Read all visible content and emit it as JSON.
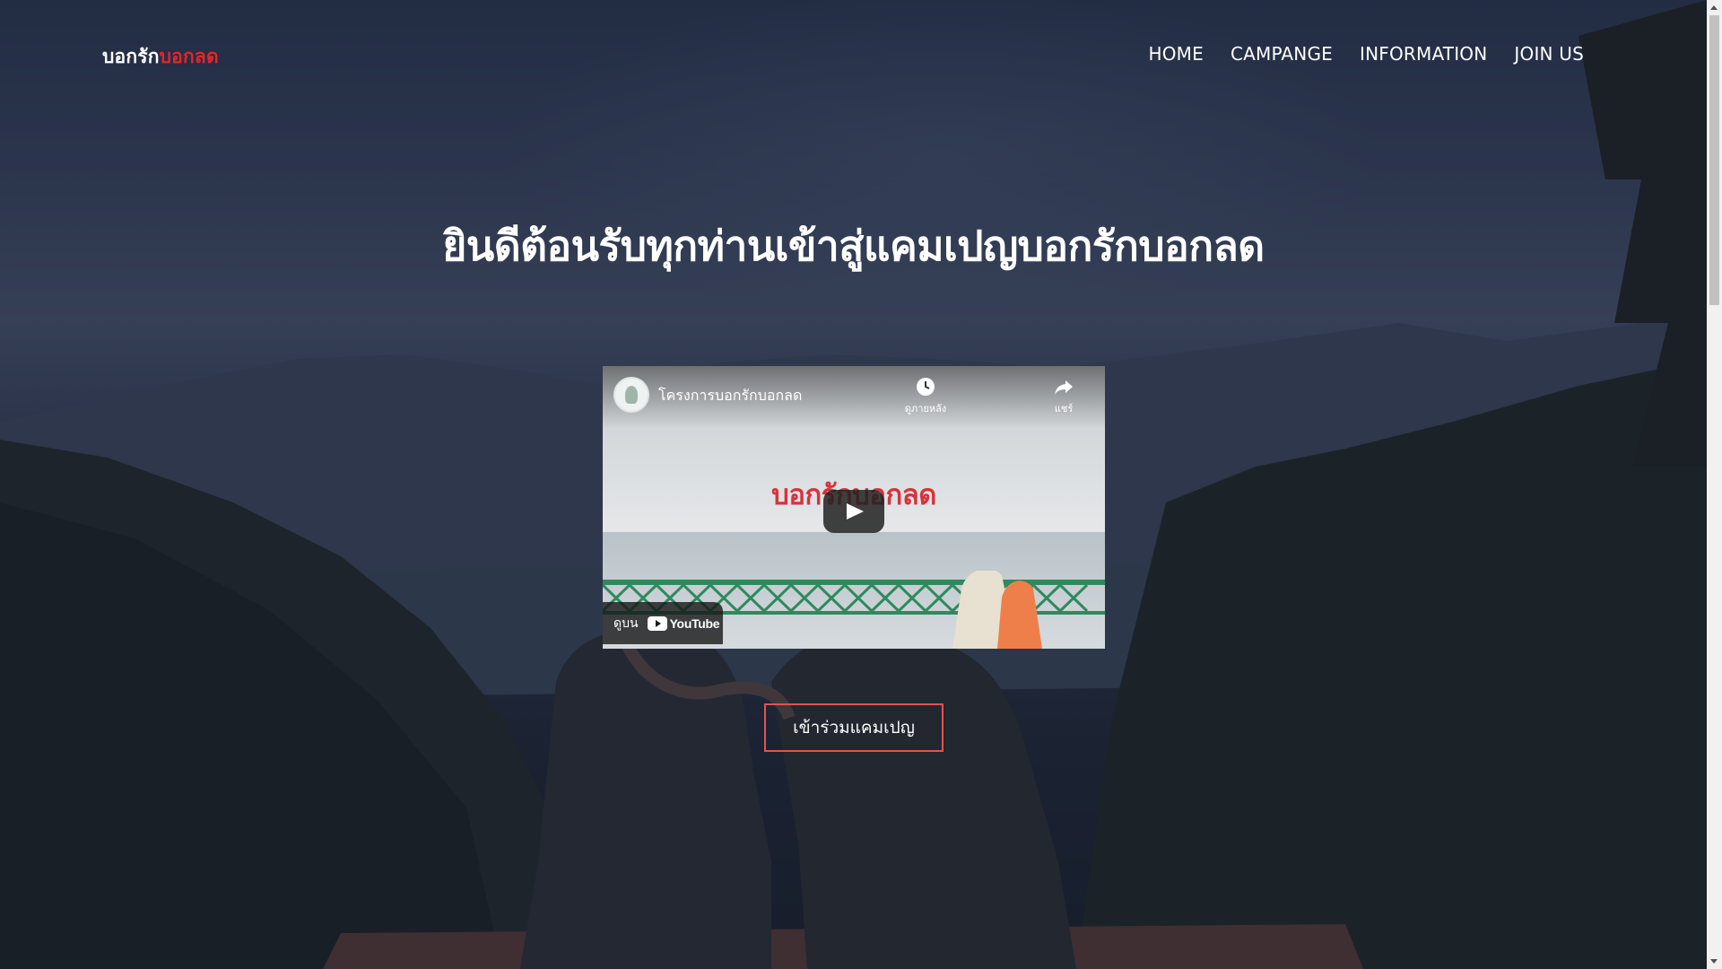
{
  "logo": {
    "main": "บอกรัก",
    "accent": "บอกลด"
  },
  "nav": {
    "items": [
      "HOME",
      "CAMPANGE",
      "INFORMATION",
      "JOIN US"
    ]
  },
  "hero": {
    "title": "ยินดีต้อนรับทุกท่านเข้าสู่แคมเปญบอกรักบอกลด"
  },
  "video": {
    "channel_title": "โครงการบอกรักบอกลด",
    "watch_later_label": "ดูภายหลัง",
    "share_label": "แชร์",
    "thumbnail_title": "บอกรักบอกลด",
    "watch_on_label": "ดูบน",
    "youtube_label": "YouTube"
  },
  "cta": {
    "label": "เข้าร่วมแคมเปญ"
  },
  "colors": {
    "accent": "#e8232a",
    "cta_border": "#e35252",
    "overlay": "#141a2c"
  }
}
